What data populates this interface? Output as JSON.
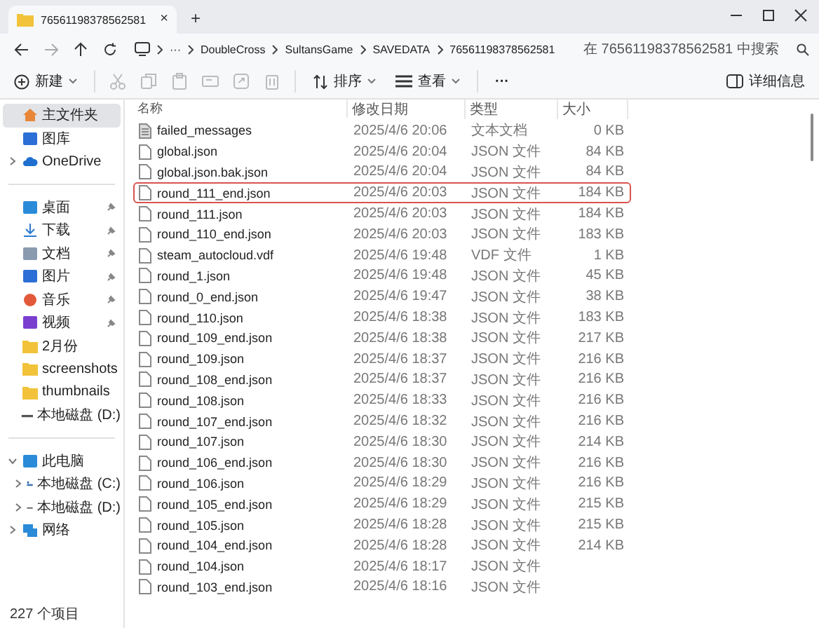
{
  "window": {
    "tab_title": "76561198378562581",
    "tab_close": "×",
    "new_tab": "+"
  },
  "address": {
    "overflow": "···",
    "crumbs": [
      "DoubleCross",
      "SultansGame",
      "SAVEDATA",
      "76561198378562581"
    ]
  },
  "search": {
    "placeholder": "在 76561198378562581 中搜索"
  },
  "toolbar": {
    "new_label": "新建",
    "tools": [
      {
        "kind": "cut",
        "disabled": true
      },
      {
        "kind": "copy",
        "disabled": true
      },
      {
        "kind": "paste",
        "disabled": true
      },
      {
        "kind": "rename",
        "disabled": true
      },
      {
        "kind": "share",
        "disabled": true
      },
      {
        "kind": "delete",
        "disabled": true
      }
    ],
    "sort_label": "排序",
    "view_label": "查看",
    "more": "···",
    "details_label": "详细信息"
  },
  "sidebar": {
    "sections": [
      {
        "items": [
          {
            "label": "主文件夹",
            "selected": true
          },
          {
            "label": "图库",
            "selected": false
          },
          {
            "label": "OneDrive",
            "selected": false,
            "expanded": false
          }
        ]
      },
      {
        "items": [
          {
            "label": "桌面",
            "selected": false,
            "pinned": true
          },
          {
            "label": "下载",
            "selected": false,
            "pinned": true
          },
          {
            "label": "文档",
            "selected": false,
            "pinned": true
          },
          {
            "label": "图片",
            "selected": false,
            "pinned": true
          },
          {
            "label": "音乐",
            "selected": false,
            "pinned": true
          },
          {
            "label": "视频",
            "selected": false,
            "pinned": true
          },
          {
            "label": "2月份",
            "selected": false
          },
          {
            "label": "screenshots",
            "selected": false
          },
          {
            "label": "thumbnails",
            "selected": false
          },
          {
            "label": "本地磁盘 (D:)",
            "selected": false
          }
        ]
      },
      {
        "items": [
          {
            "label": "此电脑",
            "selected": false,
            "expanded": true,
            "children": [
              {
                "label": "本地磁盘 (C:)",
                "selected": false,
                "expanded": false
              },
              {
                "label": "本地磁盘 (D:)",
                "selected": false,
                "expanded": false
              }
            ]
          },
          {
            "label": "网络",
            "selected": false,
            "expanded": false
          }
        ]
      }
    ]
  },
  "table": {
    "columns": [
      "名称",
      "修改日期",
      "类型",
      "大小"
    ],
    "rows": [
      {
        "name": "failed_messages",
        "kind": "text",
        "date": "2025/4/6 20:06",
        "type": "文本文档",
        "size": "0 KB",
        "marked": false
      },
      {
        "name": "global.json",
        "kind": "file",
        "date": "2025/4/6 20:04",
        "type": "JSON 文件",
        "size": "84 KB",
        "marked": false
      },
      {
        "name": "global.json.bak.json",
        "kind": "file",
        "date": "2025/4/6 20:04",
        "type": "JSON 文件",
        "size": "84 KB",
        "marked": false
      },
      {
        "name": "round_111_end.json",
        "kind": "file",
        "date": "2025/4/6 20:03",
        "type": "JSON 文件",
        "size": "184 KB",
        "marked": true
      },
      {
        "name": "round_111.json",
        "kind": "file",
        "date": "2025/4/6 20:03",
        "type": "JSON 文件",
        "size": "184 KB",
        "marked": false
      },
      {
        "name": "round_110_end.json",
        "kind": "file",
        "date": "2025/4/6 20:03",
        "type": "JSON 文件",
        "size": "183 KB",
        "marked": false
      },
      {
        "name": "steam_autocloud.vdf",
        "kind": "file",
        "date": "2025/4/6 19:48",
        "type": "VDF 文件",
        "size": "1 KB",
        "marked": false
      },
      {
        "name": "round_1.json",
        "kind": "file",
        "date": "2025/4/6 19:48",
        "type": "JSON 文件",
        "size": "45 KB",
        "marked": false
      },
      {
        "name": "round_0_end.json",
        "kind": "file",
        "date": "2025/4/6 19:47",
        "type": "JSON 文件",
        "size": "38 KB",
        "marked": false
      },
      {
        "name": "round_110.json",
        "kind": "file",
        "date": "2025/4/6 18:38",
        "type": "JSON 文件",
        "size": "183 KB",
        "marked": false
      },
      {
        "name": "round_109_end.json",
        "kind": "file",
        "date": "2025/4/6 18:38",
        "type": "JSON 文件",
        "size": "217 KB",
        "marked": false
      },
      {
        "name": "round_109.json",
        "kind": "file",
        "date": "2025/4/6 18:37",
        "type": "JSON 文件",
        "size": "216 KB",
        "marked": false
      },
      {
        "name": "round_108_end.json",
        "kind": "file",
        "date": "2025/4/6 18:37",
        "type": "JSON 文件",
        "size": "216 KB",
        "marked": false
      },
      {
        "name": "round_108.json",
        "kind": "file",
        "date": "2025/4/6 18:33",
        "type": "JSON 文件",
        "size": "216 KB",
        "marked": false
      },
      {
        "name": "round_107_end.json",
        "kind": "file",
        "date": "2025/4/6 18:32",
        "type": "JSON 文件",
        "size": "216 KB",
        "marked": false
      },
      {
        "name": "round_107.json",
        "kind": "file",
        "date": "2025/4/6 18:30",
        "type": "JSON 文件",
        "size": "214 KB",
        "marked": false
      },
      {
        "name": "round_106_end.json",
        "kind": "file",
        "date": "2025/4/6 18:30",
        "type": "JSON 文件",
        "size": "216 KB",
        "marked": false
      },
      {
        "name": "round_106.json",
        "kind": "file",
        "date": "2025/4/6 18:29",
        "type": "JSON 文件",
        "size": "216 KB",
        "marked": false
      },
      {
        "name": "round_105_end.json",
        "kind": "file",
        "date": "2025/4/6 18:29",
        "type": "JSON 文件",
        "size": "215 KB",
        "marked": false
      },
      {
        "name": "round_105.json",
        "kind": "file",
        "date": "2025/4/6 18:28",
        "type": "JSON 文件",
        "size": "215 KB",
        "marked": false
      },
      {
        "name": "round_104_end.json",
        "kind": "file",
        "date": "2025/4/6 18:28",
        "type": "JSON 文件",
        "size": "214 KB",
        "marked": false
      },
      {
        "name": "round_104.json",
        "kind": "file",
        "date": "2025/4/6 18:17",
        "type": "JSON 文件",
        "marked": false
      },
      {
        "name": "round_103_end.json",
        "kind": "file",
        "date": "2025/4/6 18:16",
        "type": "JSON 文件",
        "marked": false
      }
    ]
  },
  "status_bar": {
    "count": "227 个项目"
  }
}
